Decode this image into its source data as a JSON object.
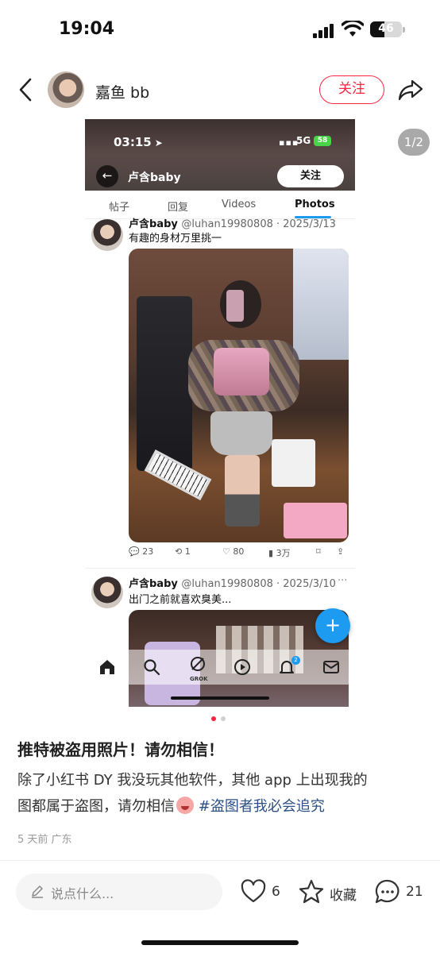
{
  "status_bar": {
    "time": "19:04",
    "battery": "46"
  },
  "header": {
    "author": "嘉鱼 bb",
    "follow_label": "关注"
  },
  "page_indicator": "1/2",
  "screenshot": {
    "status_time": "03:15",
    "network": "5G",
    "battery": "58",
    "profile_title": "卢含baby",
    "follow_label": "关注",
    "tabs": [
      "帖子",
      "回复",
      "Videos",
      "Photos"
    ],
    "tweet1": {
      "name": "卢含baby",
      "handle": "@luhan19980808 · 2025/3/13",
      "text": "有趣的身材万里挑一",
      "replies": "23",
      "retweets": "1",
      "likes": "80",
      "views": "3万"
    },
    "tweet2": {
      "name": "卢含baby",
      "handle": "@luhan19980808 · 2025/3/10",
      "more": "···",
      "text": "出门之前就喜欢臭美..."
    },
    "nav_grok_label": "GROK",
    "notification_count": "2"
  },
  "colors": {
    "brand_red": "#ff2442",
    "twitter_blue": "#1d9bf0",
    "tag_blue": "#2c4f85"
  },
  "note": {
    "title": "推特被盗用照片！请勿相信！",
    "body_line1": "除了小红书 DY 我没玩其他软件，其他 app 上出现我的",
    "body_line2": "图都属于盗图，请勿相信",
    "hashtag": "#盗图者我必会追究",
    "meta": "5 天前 广东"
  },
  "bottom_bar": {
    "comment_placeholder": "说点什么...",
    "likes": "6",
    "collect_label": "收藏",
    "comments": "21"
  }
}
